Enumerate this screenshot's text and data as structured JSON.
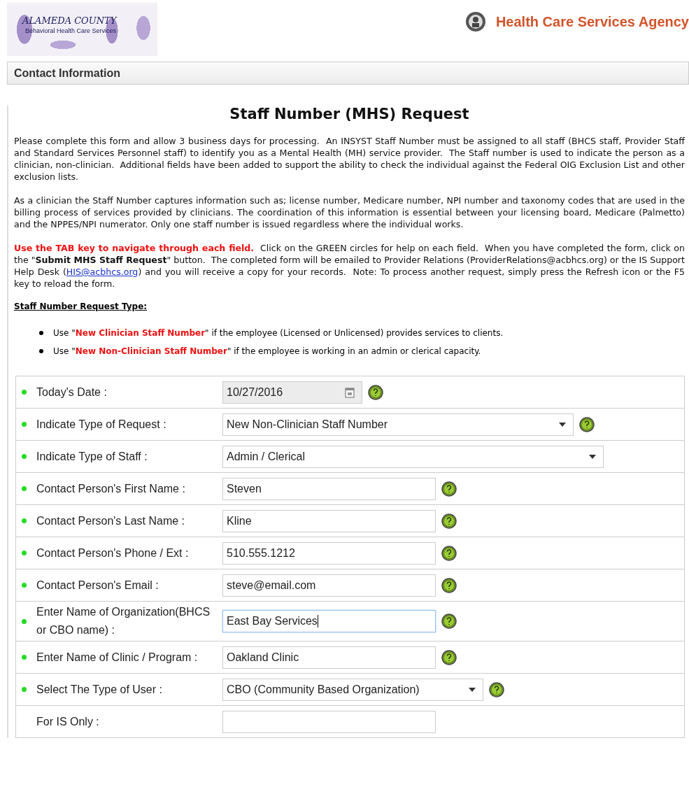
{
  "header": {
    "logo": {
      "county": "ALAMEDA COUNTY",
      "subtitle": "Behavioral Health Care Services"
    },
    "agency": "Health Care Services Agency"
  },
  "section_bar": {
    "title": "Contact Information"
  },
  "title": "Staff Number (MHS) Request",
  "intro": [
    "Please complete this form and allow 3 business days for processing.  An INSYST Staff Number must be assigned to all staff (BHCS staff, Provider Staff and Standard Services Personnel staff) to identify you as a Mental Health (MH) service provider.  The Staff number is used to indicate the person as a clinician, non-clinician.  Additional fields have been added to support the ability to check the individual against the Federal OIG Exclusion List and other exclusion lists.",
    "As a clinician the Staff Number captures information such as; license number, Medicare number, NPI number and taxonomy codes that are used in the billing process of services provided by clinicians. The coordination of this information is essential between your licensing board, Medicare (Palmetto) and the NPPES/NPI numerator. Only one staff number is issued regardless where the individual works."
  ],
  "instructions": {
    "lead": "Use the TAB key to navigate through each field.",
    "before_link": "Click on the GREEN circles for help on each field.  When you have completed the form, click on the \"**Submit MHS Staff Request**\" button.  The completed form will be emailed to Provider Relations (ProviderRelations@acbhcs.org) or the IS Support Help Desk (",
    "link": "HIS@acbhcs.org",
    "after_link": ") and you will receive a copy for your records.  Note: To process another request, simply press the Refresh icon or the F5 key to reload the form."
  },
  "request_type": {
    "heading": "Staff Number Request Type:",
    "bullets": [
      {
        "before": "Use \"",
        "highlight": "New Clinician Staff Number",
        "after": "\" if the employee (Licensed or Unlicensed) provides services to clients."
      },
      {
        "before": "Use \"",
        "highlight": "New Non-Clinician Staff Number",
        "after": "\" if the employee is working in an admin or clerical capacity."
      }
    ]
  },
  "fields": [
    {
      "label": "Today's Date :",
      "kind": "date",
      "value": "10/27/2016",
      "required": true,
      "help": true,
      "focused": false
    },
    {
      "label": "Indicate Type of Request :",
      "kind": "select",
      "value": "New Non-Clinician Staff Number",
      "required": true,
      "help": true,
      "focused": false
    },
    {
      "label": "Indicate Type of Staff :",
      "kind": "select",
      "value": "Admin / Clerical",
      "required": true,
      "help": false,
      "focused": false
    },
    {
      "label": "Contact Person's First Name :",
      "kind": "text",
      "value": "Steven",
      "required": true,
      "help": true,
      "focused": false
    },
    {
      "label": "Contact Person's Last Name :",
      "kind": "text",
      "value": "Kline",
      "required": true,
      "help": true,
      "focused": false
    },
    {
      "label": "Contact Person's Phone / Ext :",
      "kind": "text",
      "value": "510.555.1212",
      "required": true,
      "help": true,
      "focused": false
    },
    {
      "label": "Contact Person's Email :",
      "kind": "text",
      "value": "steve@email.com",
      "required": true,
      "help": true,
      "focused": false
    },
    {
      "label": "Enter Name of Organization(BHCS or CBO name) :",
      "kind": "text",
      "value": "East Bay Services",
      "required": true,
      "help": true,
      "focused": true
    },
    {
      "label": "Enter Name of Clinic / Program :",
      "kind": "text",
      "value": "Oakland Clinic",
      "required": true,
      "help": true,
      "focused": false
    },
    {
      "label": "Select The Type of User :",
      "kind": "select",
      "value": "CBO (Community Based Organization)",
      "required": true,
      "help": true,
      "focused": false
    },
    {
      "label": "For IS Only :",
      "kind": "text",
      "required": false,
      "help": false,
      "focused": false
    }
  ]
}
